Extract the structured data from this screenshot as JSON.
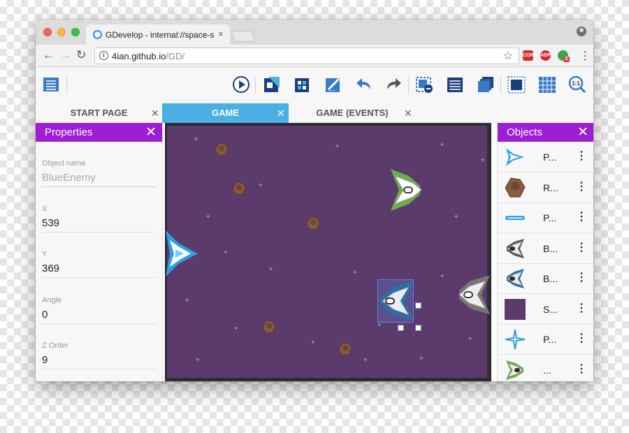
{
  "browser": {
    "tab_title": "GDevelop - internal://space-sh",
    "tab_close": "×",
    "url_host": "4ian.github.io",
    "url_path": "/GD/",
    "ext_cors": "CORS",
    "ext_abp": "ABP",
    "ext_badge": "2"
  },
  "editor_tabs": [
    {
      "label": "START PAGE",
      "active": false
    },
    {
      "label": "GAME",
      "active": true
    },
    {
      "label": "GAME (EVENTS)",
      "active": false
    }
  ],
  "close_glyph": "✕",
  "properties": {
    "title": "Properties",
    "fields": [
      {
        "label": "Object name",
        "value": "BlueEnemy",
        "placeholder": true
      },
      {
        "label": "X",
        "value": "539"
      },
      {
        "label": "Y",
        "value": "369"
      },
      {
        "label": "Angle",
        "value": "0"
      },
      {
        "label": "Z Order",
        "value": "9"
      }
    ]
  },
  "objects": {
    "title": "Objects",
    "items": [
      {
        "name": "P...",
        "icon": "player-ship-icon"
      },
      {
        "name": "R...",
        "icon": "rock-icon"
      },
      {
        "name": "P...",
        "icon": "laser-icon"
      },
      {
        "name": "B...",
        "icon": "blue-enemy-icon"
      },
      {
        "name": "B...",
        "icon": "blue-enemy-icon"
      },
      {
        "name": "S...",
        "icon": "space-bg-icon"
      },
      {
        "name": "P...",
        "icon": "particle-icon"
      },
      {
        "name": "...",
        "icon": "enemy-icon"
      }
    ]
  },
  "colors": {
    "accent": "#9c1fd4",
    "active_tab": "#4ab0e4",
    "scene_bg": "#5b3b6c"
  }
}
